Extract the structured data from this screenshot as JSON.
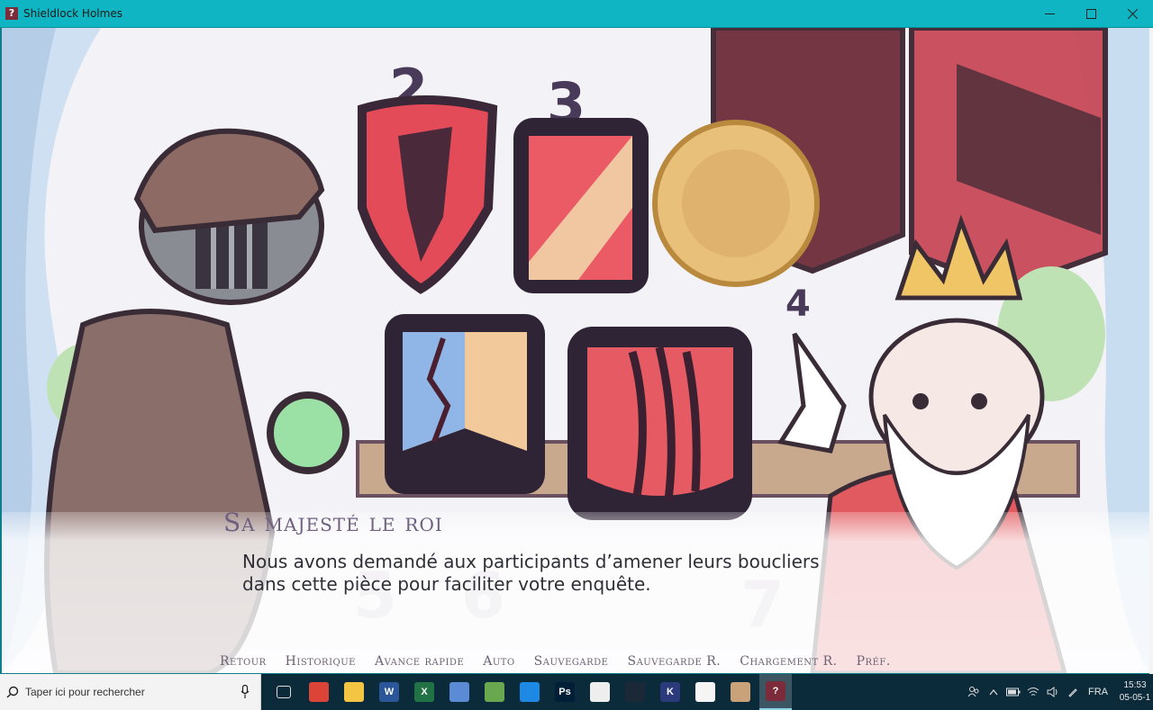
{
  "window": {
    "title": "Shieldlock Holmes",
    "app_icon_glyph": "?"
  },
  "scene": {
    "numbers": [
      "2",
      "3",
      "4",
      "5",
      "6",
      "7"
    ]
  },
  "dialogue": {
    "speaker": "Sa majesté le roi",
    "line1": "Nous avons demandé aux participants d’amener leurs boucliers",
    "line2": "dans cette pièce pour faciliter votre enquête."
  },
  "quick_menu": [
    "Retour",
    "Historique",
    "Avance rapide",
    "Auto",
    "Sauvegarde",
    "Sauvegarde R.",
    "Chargement R.",
    "Préf."
  ],
  "taskbar": {
    "search_placeholder": "Taper ici pour rechercher",
    "apps": [
      {
        "name": "task-view",
        "label": "",
        "color": "#0c2b3a"
      },
      {
        "name": "chrome",
        "label": "",
        "color": "#db4437"
      },
      {
        "name": "file-explorer",
        "label": "",
        "color": "#f4c542"
      },
      {
        "name": "word",
        "label": "W",
        "color": "#2b579a"
      },
      {
        "name": "excel",
        "label": "X",
        "color": "#217346"
      },
      {
        "name": "paint-app",
        "label": "",
        "color": "#5c8bd6"
      },
      {
        "name": "globe-app",
        "label": "",
        "color": "#6aa84f"
      },
      {
        "name": "window-app",
        "label": "",
        "color": "#1e88e5"
      },
      {
        "name": "photoshop",
        "label": "Ps",
        "color": "#001e36"
      },
      {
        "name": "piano-app",
        "label": "",
        "color": "#eeeeee"
      },
      {
        "name": "steam",
        "label": "",
        "color": "#1b2838"
      },
      {
        "name": "k-app",
        "label": "K",
        "color": "#2a3a7a"
      },
      {
        "name": "sticky-app",
        "label": "",
        "color": "#f5f5f5"
      },
      {
        "name": "figure-app",
        "label": "",
        "color": "#c9a27a"
      },
      {
        "name": "shieldlock-app",
        "label": "?",
        "color": "#7b2b3a"
      }
    ],
    "language": "FRA",
    "time": "15:53",
    "date": "05-05-1"
  }
}
